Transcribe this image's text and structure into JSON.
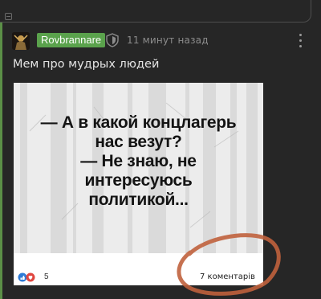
{
  "post": {
    "author": "Rovbrannare",
    "timestamp": "11 минут назад",
    "text": "Мем про мудрых людей"
  },
  "meme": {
    "lines": [
      "— А в какой концлагерь",
      "нас везут?",
      "— Не знаю, не",
      "интересуюсь",
      "политикой..."
    ],
    "reaction_count": "5",
    "comments_label": "7 коментарів"
  },
  "colors": {
    "user_badge": "#5aa24c",
    "thread_line": "#5b8f47",
    "annotation_circle": "#c0623d"
  },
  "icons": [
    "collapse-icon",
    "shield-icon",
    "more-vertical-icon",
    "reaction-icons"
  ]
}
